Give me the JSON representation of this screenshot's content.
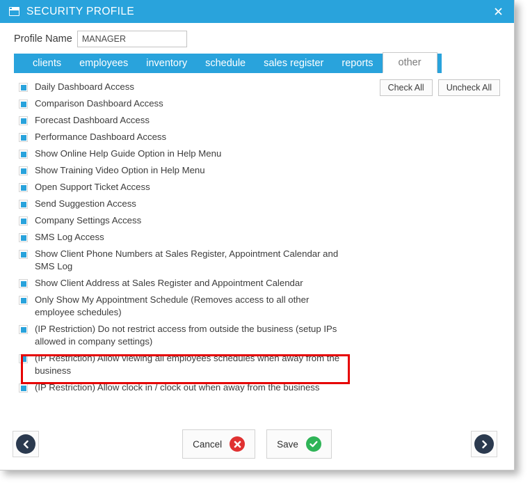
{
  "window": {
    "title": "SECURITY PROFILE",
    "title_icon": "window-form-icon",
    "close_icon": "close-icon",
    "accent_color": "#29a3dc"
  },
  "profile": {
    "label": "Profile Name",
    "value": "MANAGER",
    "placeholder": ""
  },
  "tabs": [
    {
      "label": "clients",
      "active": false
    },
    {
      "label": "employees",
      "active": false
    },
    {
      "label": "inventory",
      "active": false
    },
    {
      "label": "schedule",
      "active": false
    },
    {
      "label": "sales register",
      "active": false
    },
    {
      "label": "reports",
      "active": false
    },
    {
      "label": "other",
      "active": true
    }
  ],
  "bulk": {
    "check_all": "Check All",
    "uncheck_all": "Uncheck All"
  },
  "permissions": [
    {
      "label": "Daily Dashboard Access",
      "checked": true
    },
    {
      "label": "Comparison Dashboard Access",
      "checked": true
    },
    {
      "label": "Forecast Dashboard Access",
      "checked": true
    },
    {
      "label": "Performance Dashboard Access",
      "checked": true
    },
    {
      "label": "Show Online Help Guide Option in Help Menu",
      "checked": true
    },
    {
      "label": "Show Training Video Option in Help Menu",
      "checked": true
    },
    {
      "label": "Open Support Ticket Access",
      "checked": true
    },
    {
      "label": "Send Suggestion Access",
      "checked": true
    },
    {
      "label": "Company Settings Access",
      "checked": true
    },
    {
      "label": "SMS Log Access",
      "checked": true
    },
    {
      "label": "Show Client Phone Numbers at Sales Register, Appointment Calendar and SMS Log",
      "checked": true
    },
    {
      "label": "Show Client Address at Sales Register and Appointment Calendar",
      "checked": true
    },
    {
      "label": "Only Show My Appointment Schedule (Removes access to all other employee schedules)",
      "checked": true
    },
    {
      "label": "(IP Restriction) Do not restrict access from outside the business (setup IPs allowed in company settings)",
      "checked": true
    },
    {
      "label": "(IP Restriction) Allow viewing all employees schedules when away from the business",
      "checked": true
    },
    {
      "label": "(IP Restriction) Allow clock in / clock out when away from the business",
      "checked": true
    }
  ],
  "highlight": {
    "target_label": "Only Show My Appointment Schedule (Removes access to all other employee schedules)",
    "color": "#e60000"
  },
  "footer": {
    "prev_icon": "chevron-left-icon",
    "next_icon": "chevron-right-icon",
    "cancel_label": "Cancel",
    "cancel_icon": "cancel-x-circle-icon",
    "save_label": "Save",
    "save_icon": "check-circle-icon"
  }
}
